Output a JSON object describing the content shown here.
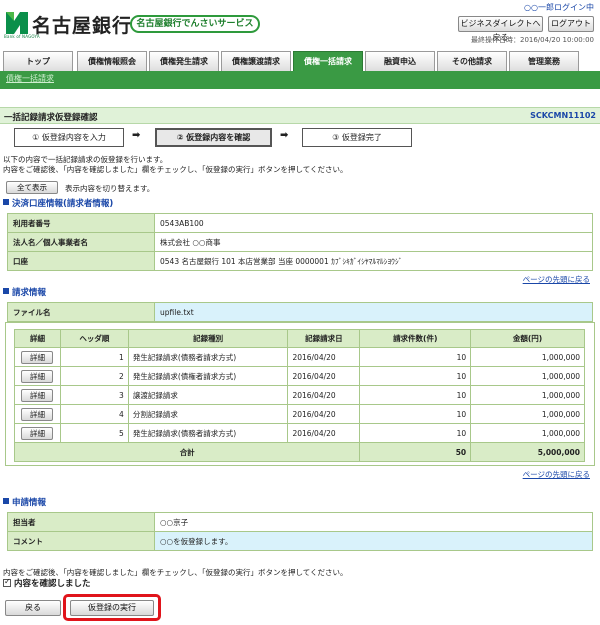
{
  "header": {
    "bank_name": "名古屋銀行",
    "logo_sub": "Bank of NAGOYA",
    "service_name": "名古屋銀行でんさいサービス",
    "login_user": "○○一郎ログイン中",
    "direct_button": "ビジネスダイレクトへ戻る",
    "logout_button": "ログアウト",
    "last_operation": "最終操作日時：2016/04/20 10:00:00"
  },
  "tabs": [
    "トップ",
    "債権情報照会",
    "債権発生請求",
    "債権譲渡請求",
    "債権一括請求",
    "融資申込",
    "その他請求",
    "管理業務"
  ],
  "active_tab": "債権一括請求",
  "breadcrumb": "債権一括請求",
  "page": {
    "title": "一括記録請求仮登録確認",
    "screen_code": "SCKCMN11102"
  },
  "steps": {
    "step1": "① 仮登録内容を入力",
    "step2": "② 仮登録内容を確認",
    "step3": "③ 仮登録完了",
    "arrow": "➡"
  },
  "intro": {
    "line1": "以下の内容で一括記録請求の仮登録を行います。",
    "line2": "内容をご確認後、「内容を確認しました」欄をチェックし、「仮登録の実行」ボタンを押してください。",
    "show_all_button": "全て表示",
    "show_all_text": "表示内容を切り替えます。"
  },
  "settlement": {
    "heading": "決済口座情報(請求者情報)",
    "user_no_label": "利用者番号",
    "user_no": "0543AB100",
    "corp_label": "法人名／個人事業者名",
    "corp": "株式会社 ○○商事",
    "account_label": "口座",
    "account": "0543 名古屋銀行 101 本店営業部 当座 0000001 ｶﾌﾞｼｷｶﾞｲｼﾔﾏﾙﾏﾙｼﾖｳｼﾞ"
  },
  "to_top": "ページの先頭に戻る",
  "request": {
    "heading": "請求情報",
    "file_label": "ファイル名",
    "file_name": "upfile.txt",
    "columns": [
      "詳細",
      "ヘッダ順",
      "記録種別",
      "記録請求日",
      "請求件数(件)",
      "金額(円)"
    ],
    "detail_label": "詳細",
    "rows": [
      {
        "order": "1",
        "type": "発生記録請求(債務者請求方式)",
        "date": "2016/04/20",
        "count": "10",
        "amount": "1,000,000"
      },
      {
        "order": "2",
        "type": "発生記録請求(債権者請求方式)",
        "date": "2016/04/20",
        "count": "10",
        "amount": "1,000,000"
      },
      {
        "order": "3",
        "type": "譲渡記録請求",
        "date": "2016/04/20",
        "count": "10",
        "amount": "1,000,000"
      },
      {
        "order": "4",
        "type": "分割記録請求",
        "date": "2016/04/20",
        "count": "10",
        "amount": "1,000,000"
      },
      {
        "order": "5",
        "type": "発生記録請求(債務者請求方式)",
        "date": "2016/04/20",
        "count": "10",
        "amount": "1,000,000"
      }
    ],
    "total_label": "合計",
    "total_count": "50",
    "total_amount": "5,000,000"
  },
  "application": {
    "heading": "申請情報",
    "person_label": "担当者",
    "person": "○○京子",
    "comment_label": "コメント",
    "comment": "○○を仮登録します。"
  },
  "confirm": {
    "text": "内容をご確認後、「内容を確認しました」欄をチェックし、「仮登録の実行」ボタンを押してください。",
    "checkbox_label": "内容を確認しました",
    "checked": true
  },
  "footer": {
    "back_button": "戻る",
    "execute_button": "仮登録の実行"
  },
  "colors": {
    "brand_green": "#3a9a44",
    "link_blue": "#1a47a8",
    "highlight_red": "#e0141b"
  }
}
